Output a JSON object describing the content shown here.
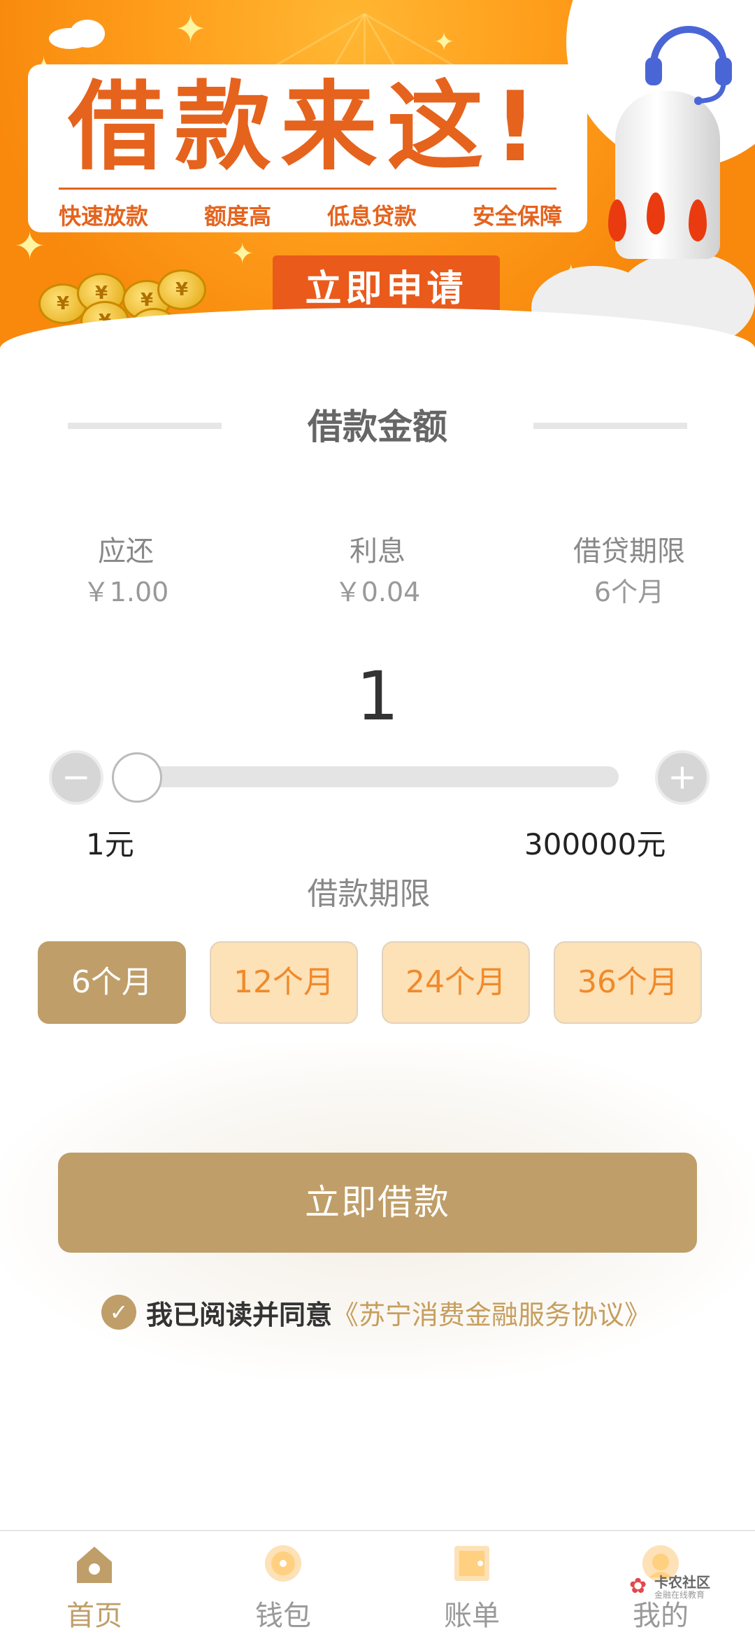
{
  "banner": {
    "title": "借款来这!",
    "features": [
      "快速放款",
      "额度高",
      "低息贷款",
      "安全保障"
    ],
    "apply_label": "立即申请",
    "coin_symbol": "¥"
  },
  "section": {
    "title": "借款金额"
  },
  "summary": [
    {
      "label": "应还",
      "value": "￥1.00"
    },
    {
      "label": "利息",
      "value": "￥0.04"
    },
    {
      "label": "借贷期限",
      "value": "6个月"
    }
  ],
  "amount": {
    "value": "1",
    "min_label": "1元",
    "max_label": "300000元",
    "decrease_symbol": "−",
    "increase_symbol": "+"
  },
  "term": {
    "title": "借款期限",
    "options": [
      "6个月",
      "12个月",
      "24个月",
      "36个月"
    ],
    "selected": "6个月"
  },
  "loan_button": {
    "label": "立即借款"
  },
  "agreement": {
    "text": "我已阅读并同意",
    "link": "《苏宁消费金融服务协议》",
    "check_symbol": "✓"
  },
  "tabbar": {
    "items": [
      {
        "label": "首页",
        "icon": "home-icon",
        "active": true
      },
      {
        "label": "钱包",
        "icon": "wallet-icon",
        "active": false
      },
      {
        "label": "账单",
        "icon": "bill-icon",
        "active": false
      },
      {
        "label": "我的",
        "icon": "profile-icon",
        "active": false
      }
    ]
  },
  "watermark": {
    "title": "卡农社区",
    "subtitle": "金融在线教育"
  },
  "colors": {
    "accent": "#bf9e69",
    "banner_orange": "#f8890d",
    "banner_red": "#e5631d",
    "term_idle_bg": "#fde1b7",
    "term_idle_text": "#f08a2a"
  }
}
